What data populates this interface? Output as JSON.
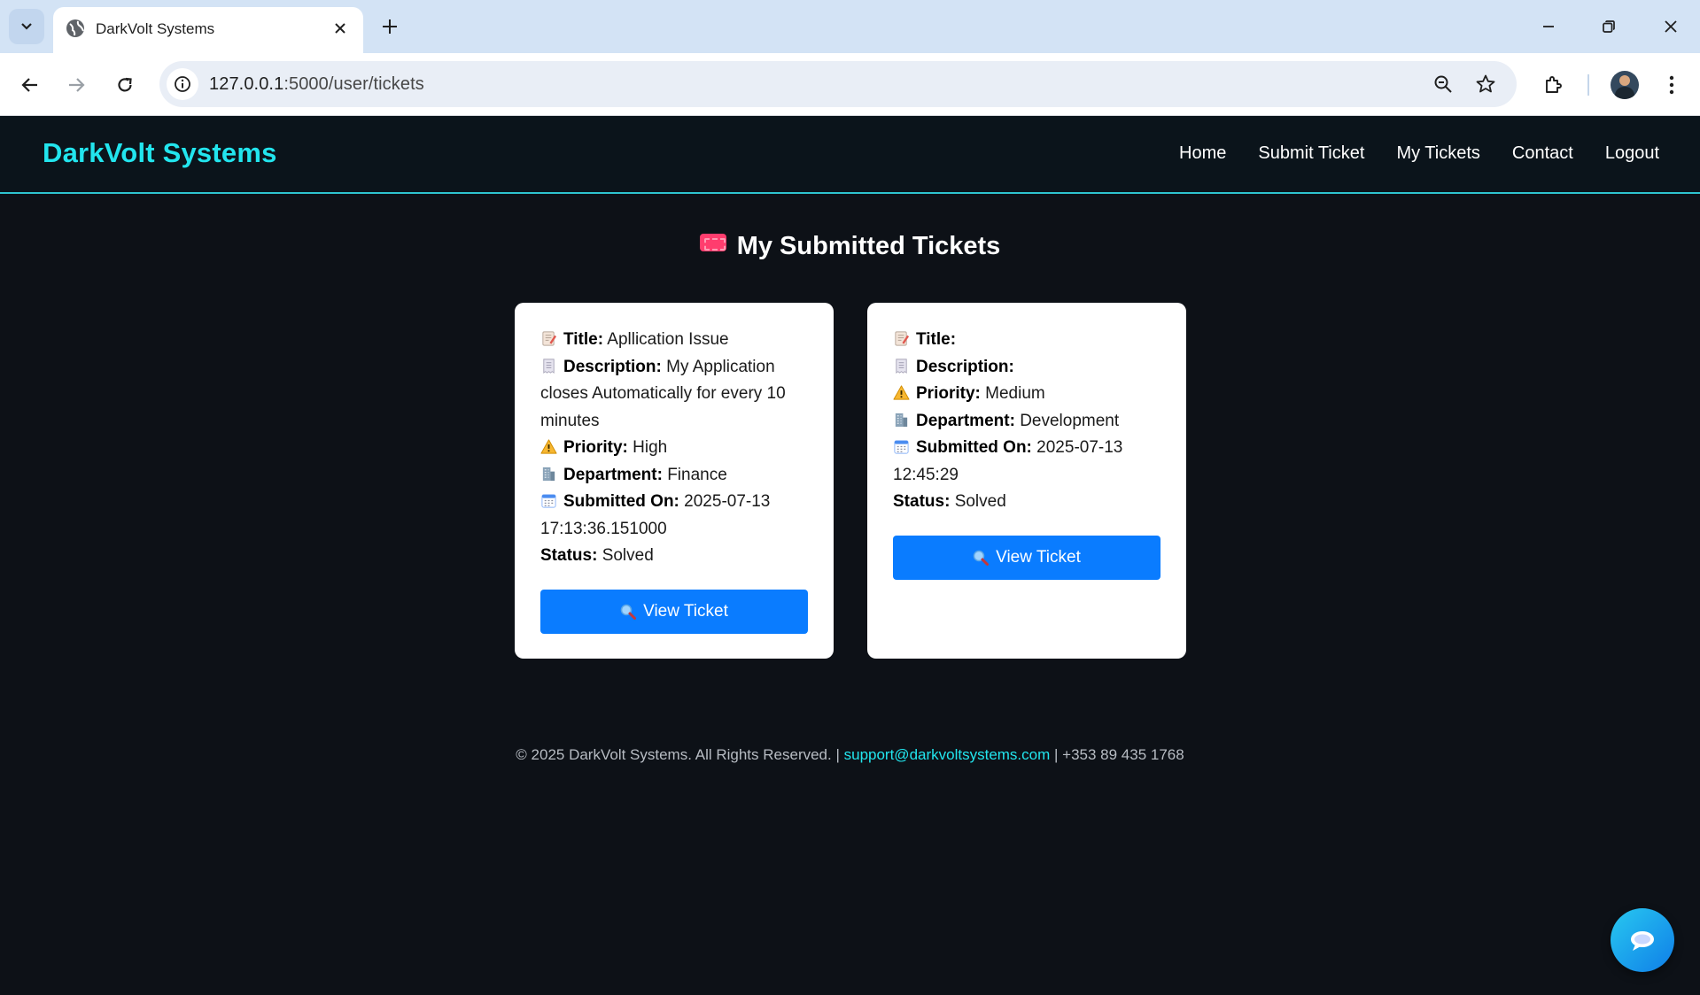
{
  "browser": {
    "tab_title": "DarkVolt Systems",
    "url_host": "127.0.0.1",
    "url_path": ":5000/user/tickets"
  },
  "site": {
    "brand": "DarkVolt Systems",
    "nav": [
      "Home",
      "Submit Ticket",
      "My Tickets",
      "Contact",
      "Logout"
    ],
    "accent_color": "#22e5ee",
    "button_color": "#0a7cff"
  },
  "page": {
    "title": "My Submitted Tickets"
  },
  "labels": {
    "title": "Title:",
    "description": "Description:",
    "priority": "Priority:",
    "department": "Department:",
    "submitted_on": "Submitted On:",
    "status": "Status:",
    "view_button": "View Ticket"
  },
  "tickets": [
    {
      "title": "Apllication Issue",
      "description": "My Application closes Automatically for every 10 minutes",
      "priority": "High",
      "department": "Finance",
      "submitted_on": "2025-07-13 17:13:36.151000",
      "status": "Solved"
    },
    {
      "title": "",
      "description": "",
      "priority": "Medium",
      "department": "Development",
      "submitted_on": "2025-07-13 12:45:29",
      "status": "Solved"
    }
  ],
  "footer": {
    "copyright": "© 2025 DarkVolt Systems. All Rights Reserved. |",
    "email": "support@darkvoltsystems.com",
    "phone": "| +353 89 435 1768"
  },
  "icons": {
    "title": "memo-icon",
    "description": "receipt-icon",
    "priority": "warning-icon",
    "department": "office-building-icon",
    "submitted_on": "calendar-icon",
    "view": "magnifier-icon",
    "chat": "chat-bubble-icon"
  }
}
